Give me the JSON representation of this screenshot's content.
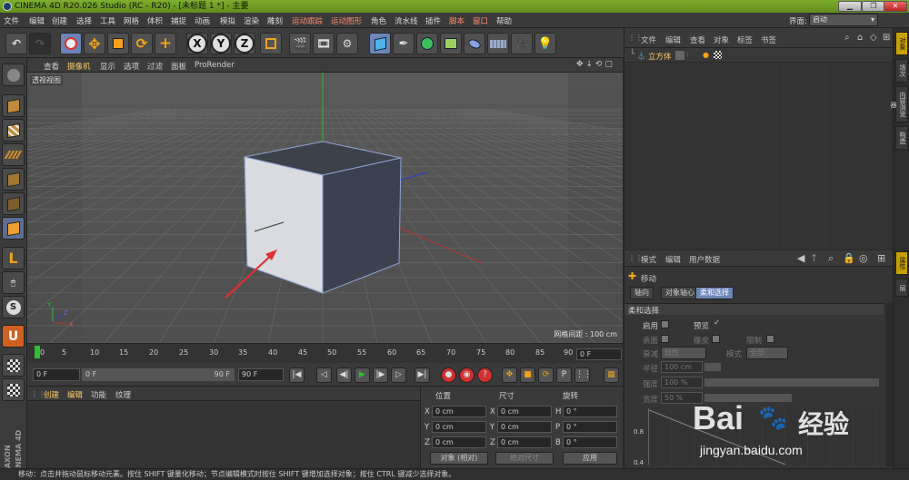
{
  "window": {
    "title": "CINEMA 4D R20.026 Studio (RC - R20) - [未标题 1 *] - 主要"
  },
  "menubar": {
    "items": [
      "文件",
      "编辑",
      "创建",
      "选择",
      "工具",
      "网格",
      "体积",
      "捕捉",
      "动画",
      "模拟",
      "渲染",
      "雕刻",
      "运动跟踪",
      "运动图形",
      "角色",
      "流水线",
      "插件",
      "脚本",
      "窗口",
      "帮助"
    ],
    "layout_label": "界面:",
    "layout_value": "启动"
  },
  "toolbar": {
    "axis_x": "X",
    "axis_y": "Y",
    "axis_z": "Z",
    "icons": [
      "undo-icon",
      "redo-icon",
      "live-select-icon",
      "move-icon",
      "scale-icon",
      "rotate-icon",
      "add-icon",
      "x-axis-lock",
      "y-axis-lock",
      "z-axis-lock",
      "coordinate-system-icon",
      "render-view-icon",
      "render-picture-viewer-icon",
      "edit-render-settings-icon",
      "cube-primitive-icon",
      "pen-spline-icon",
      "subdivision-surface-icon",
      "array-generator-icon",
      "deformer-icon",
      "floor-icon",
      "camera-icon",
      "light-icon"
    ]
  },
  "viewport": {
    "menu": [
      "查看",
      "摄像机",
      "显示",
      "选项",
      "过滤",
      "面板",
      "ProRender"
    ],
    "camera_label": "透视视图",
    "grid_info": "网格间距 : 100 cm",
    "accent": "#e03030"
  },
  "timeline": {
    "ticks": [
      "0",
      "5",
      "10",
      "15",
      "20",
      "25",
      "30",
      "35",
      "40",
      "45",
      "50",
      "55",
      "60",
      "65",
      "70",
      "75",
      "80",
      "85",
      "90"
    ],
    "current_frame": "0 F"
  },
  "playback": {
    "start": "0 F",
    "slider_start": "0 F",
    "slider_end": "90 F",
    "end": "90 F"
  },
  "material_manager": {
    "menu": [
      "创建",
      "编辑",
      "功能",
      "纹理"
    ]
  },
  "coordinates": {
    "headers": [
      "位置",
      "尺寸",
      "旋转"
    ],
    "rows": [
      {
        "axis_a": "X",
        "pos": "0 cm",
        "axis_b": "X",
        "size": "0 cm",
        "axis_c": "H",
        "rot": "0 °"
      },
      {
        "axis_a": "Y",
        "pos": "0 cm",
        "axis_b": "Y",
        "size": "0 cm",
        "axis_c": "P",
        "rot": "0 °"
      },
      {
        "axis_a": "Z",
        "pos": "0 cm",
        "axis_b": "Z",
        "size": "0 cm",
        "axis_c": "B",
        "rot": "0 °"
      }
    ],
    "mode": "对象 (相对)",
    "size_mode": "绝对尺寸",
    "apply": "应用"
  },
  "object_manager": {
    "menu": [
      "文件",
      "编辑",
      "查看",
      "对象",
      "标签",
      "书签"
    ],
    "objects": [
      {
        "name": "立方体"
      }
    ]
  },
  "attributes": {
    "menu": [
      "模式",
      "编辑",
      "用户数据"
    ],
    "tool_name": "移动",
    "tabs": [
      "轴向",
      "对象轴心",
      "柔和选择"
    ],
    "active_tab": 2,
    "section": "柔和选择",
    "enable": "启用",
    "preview": "预览",
    "surface": "表面",
    "rubber": "橡皮",
    "restrict": "限制",
    "falloff_label": "衰减",
    "falloff_value": "线性",
    "mode_label": "模式",
    "mode_value": "全部",
    "radius_label": "半径",
    "radius_value": "100 cm",
    "strength_label": "强度",
    "strength_value": "100 %",
    "width_label": "宽度",
    "width_value": "50 %",
    "graph_ticks": [
      "0.8",
      "0.4"
    ]
  },
  "side_tabs": [
    "对象",
    "场次",
    "内容浏览器",
    "构造",
    "属性",
    "层"
  ],
  "status": "移动：点击并拖动鼠标移动元素。按住 SHIFT 键量化移动；节点编辑模式时按住 SHIFT 键增加选择对象；按住 CTRL 键减少选择对象。",
  "watermark": {
    "brand": "Bai",
    "brand2": "经验",
    "url": "jingyan.baidu.com"
  }
}
